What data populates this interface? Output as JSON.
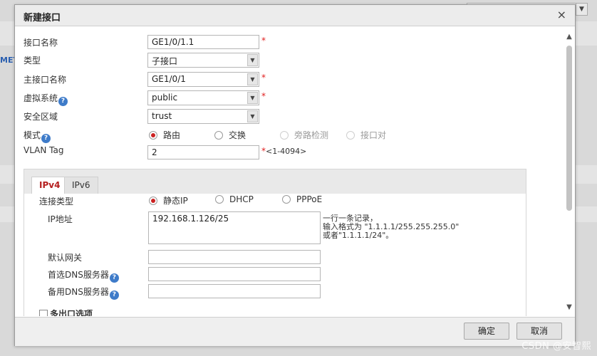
{
  "background": {
    "left_fragment": "MET",
    "watermark": "CSDN @安智熙"
  },
  "dialog": {
    "title": "新建接口",
    "close_glyph": "×",
    "required_mark": "*",
    "fields": {
      "interface_name": {
        "label": "接口名称",
        "value": "GE1/0/1.1"
      },
      "type": {
        "label": "类型",
        "value": "子接口"
      },
      "main_interface": {
        "label": "主接口名称",
        "value": "GE1/0/1"
      },
      "vsys": {
        "label": "虚拟系统",
        "value": "public"
      },
      "zone": {
        "label": "安全区域",
        "value": "trust"
      },
      "mode": {
        "label": "模式",
        "options": [
          "路由",
          "交换",
          "旁路检测",
          "接口对"
        ],
        "selected": "路由"
      },
      "vlan": {
        "label": "VLAN Tag",
        "value": "2",
        "range": "<1-4094>"
      }
    },
    "tabs": [
      {
        "label": "IPv4",
        "active": true
      },
      {
        "label": "IPv6",
        "active": false
      }
    ],
    "ipv4": {
      "conn_type": {
        "label": "连接类型",
        "options": [
          "静态IP",
          "DHCP",
          "PPPoE"
        ],
        "selected": "静态IP"
      },
      "ip": {
        "label": "IP地址",
        "value": "192.168.1.126/25",
        "hint_lines": [
          "一行一条记录，",
          "输入格式为 \"1.1.1.1/255.255.255.0\"",
          "或者\"1.1.1.1/24\"。"
        ]
      },
      "gateway": {
        "label": "默认网关",
        "value": ""
      },
      "dns1": {
        "label": "首选DNS服务器",
        "value": ""
      },
      "dns2": {
        "label": "备用DNS服务器",
        "value": ""
      },
      "multi_egress": {
        "label": "多出口选项",
        "checked": false
      }
    },
    "buttons": {
      "ok": "确定",
      "cancel": "取消"
    },
    "help_glyph": "?"
  },
  "colors": {
    "accent_red": "#c22222",
    "help_blue": "#3e7bc9"
  }
}
